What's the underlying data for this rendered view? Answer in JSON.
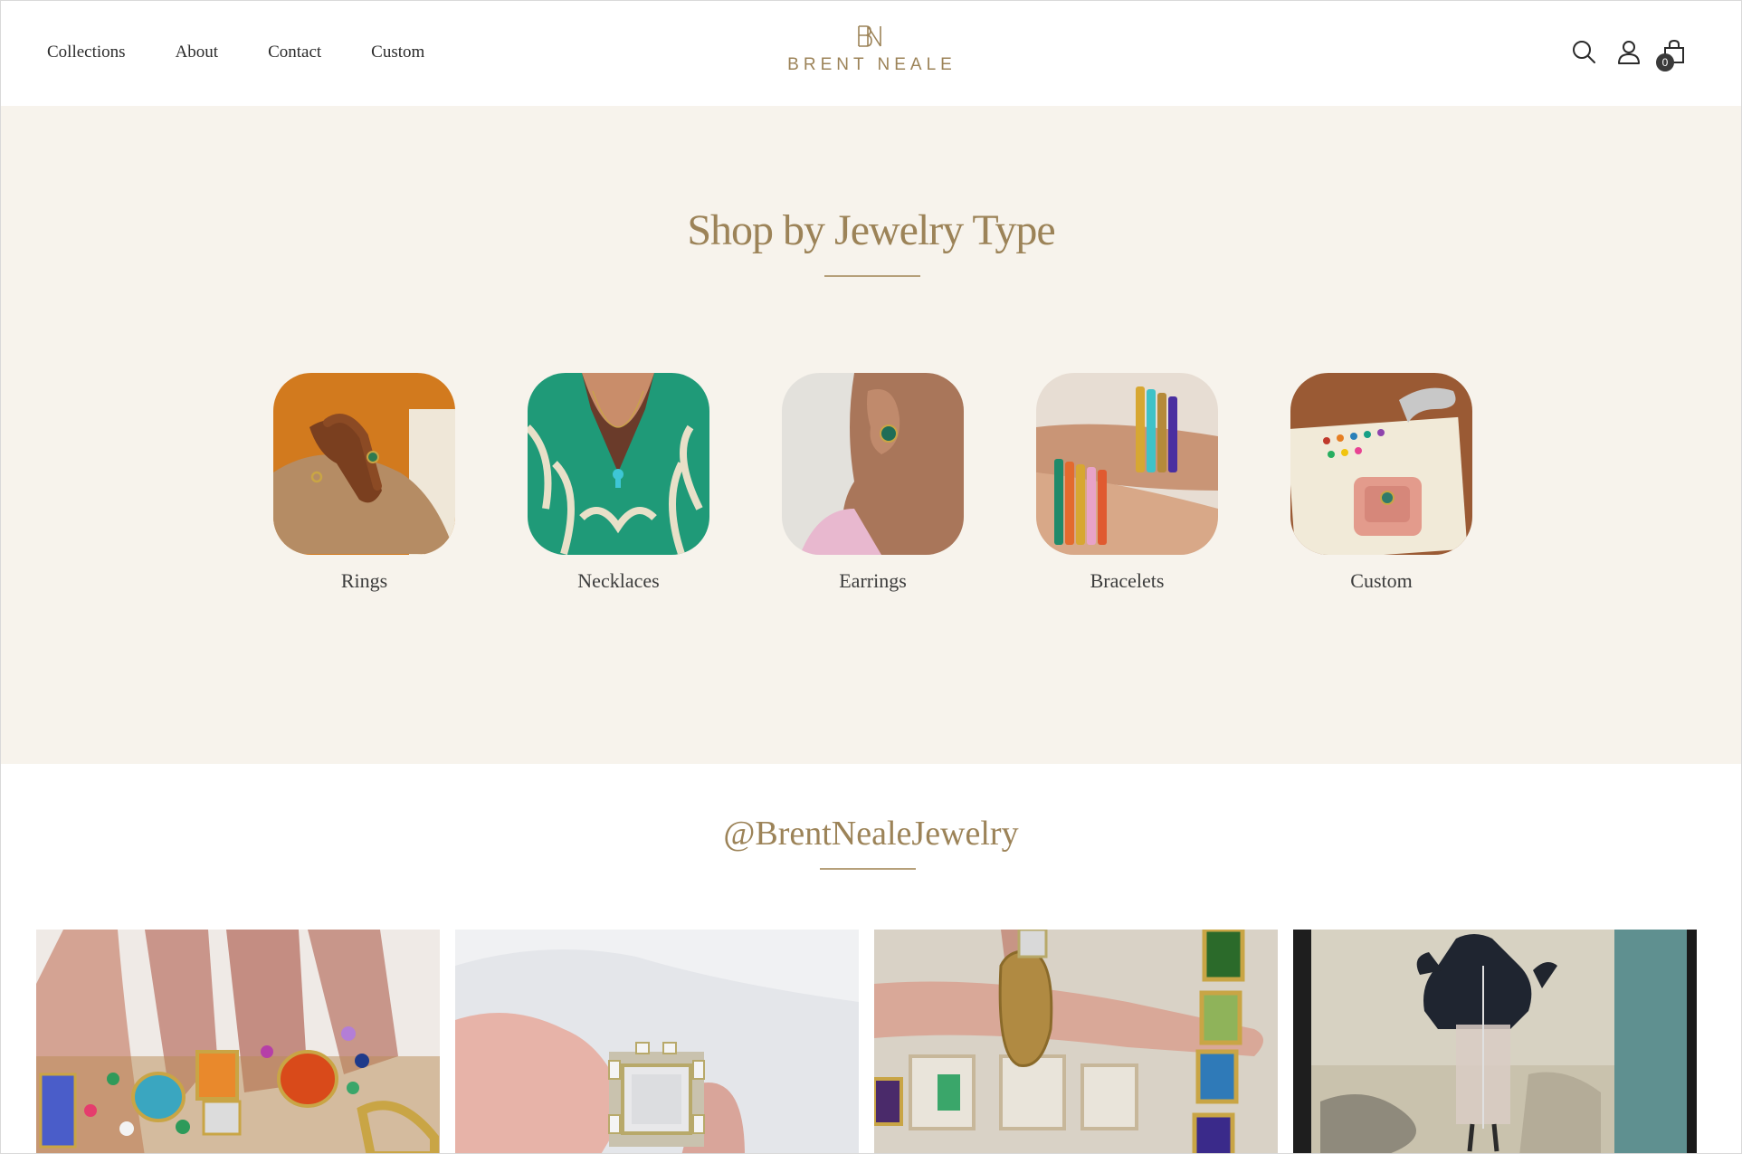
{
  "header": {
    "nav": [
      "Collections",
      "About",
      "Contact",
      "Custom"
    ],
    "logo_text": "BRENT NEALE",
    "cart_count": "0",
    "icons": [
      "search-icon",
      "account-icon",
      "cart-icon"
    ]
  },
  "shop": {
    "title": "Shop by Jewelry Type",
    "categories": [
      {
        "label": "Rings"
      },
      {
        "label": "Necklaces"
      },
      {
        "label": "Earrings"
      },
      {
        "label": "Bracelets"
      },
      {
        "label": "Custom"
      }
    ]
  },
  "instagram": {
    "title": "@BrentNealeJewelry"
  },
  "colors": {
    "accent_gold": "#9c8358",
    "section_bg": "#f7f3ec"
  }
}
